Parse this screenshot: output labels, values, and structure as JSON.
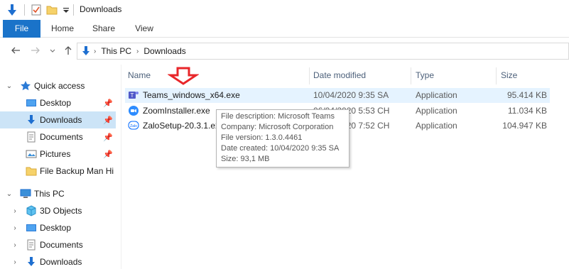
{
  "window": {
    "title": "Downloads"
  },
  "quick_toolbar": {
    "icons": [
      "down-arrow-icon",
      "properties-check-icon",
      "new-folder-icon",
      "customize-dropdown-icon"
    ]
  },
  "ribbon": {
    "tabs": [
      "File",
      "Home",
      "Share",
      "View"
    ]
  },
  "address_bar": {
    "crumbs": [
      "This PC",
      "Downloads"
    ]
  },
  "sidebar": {
    "items": [
      {
        "label": "Quick access",
        "icon": "star-icon",
        "expanded": true
      },
      {
        "label": "Desktop",
        "icon": "desktop-folder-icon",
        "pinned": true
      },
      {
        "label": "Downloads",
        "icon": "download-folder-icon",
        "pinned": true,
        "selected": true
      },
      {
        "label": "Documents",
        "icon": "documents-folder-icon",
        "pinned": true
      },
      {
        "label": "Pictures",
        "icon": "pictures-folder-icon",
        "pinned": true
      },
      {
        "label": "File Backup Man Hi",
        "icon": "folder-icon"
      },
      {
        "label": "This PC",
        "icon": "computer-icon",
        "expanded": true
      },
      {
        "label": "3D Objects",
        "icon": "3d-objects-icon"
      },
      {
        "label": "Desktop",
        "icon": "desktop-folder-icon"
      },
      {
        "label": "Documents",
        "icon": "documents-folder-icon"
      },
      {
        "label": "Downloads",
        "icon": "download-folder-icon"
      }
    ]
  },
  "file_list": {
    "columns": [
      "Name",
      "Date modified",
      "Type",
      "Size"
    ],
    "rows": [
      {
        "name": "Teams_windows_x64.exe",
        "date": "10/04/2020 9:35 SA",
        "type": "Application",
        "size": "95.414 KB",
        "icon": "teams-icon"
      },
      {
        "name": "ZoomInstaller.exe",
        "date": "06/04/2020 5:53 CH",
        "type": "Application",
        "size": "11.034 KB",
        "icon": "zoom-icon"
      },
      {
        "name": "ZaloSetup-20.3.1.exe",
        "date": "02/04/2020 7:52 CH",
        "type": "Application",
        "size": "104.947 KB",
        "icon": "zalo-icon"
      }
    ]
  },
  "tooltip": {
    "lines": [
      "File description: Microsoft Teams",
      "Company: Microsoft Corporation",
      "File version: 1.3.0.4461",
      "Date created: 10/04/2020 9:35 SA",
      "Size: 93,1 MB"
    ]
  },
  "colors": {
    "accent": "#1a73c9",
    "selection": "#cce4f7",
    "hover": "#e5f3ff",
    "annotation_arrow": "#e8262a"
  }
}
